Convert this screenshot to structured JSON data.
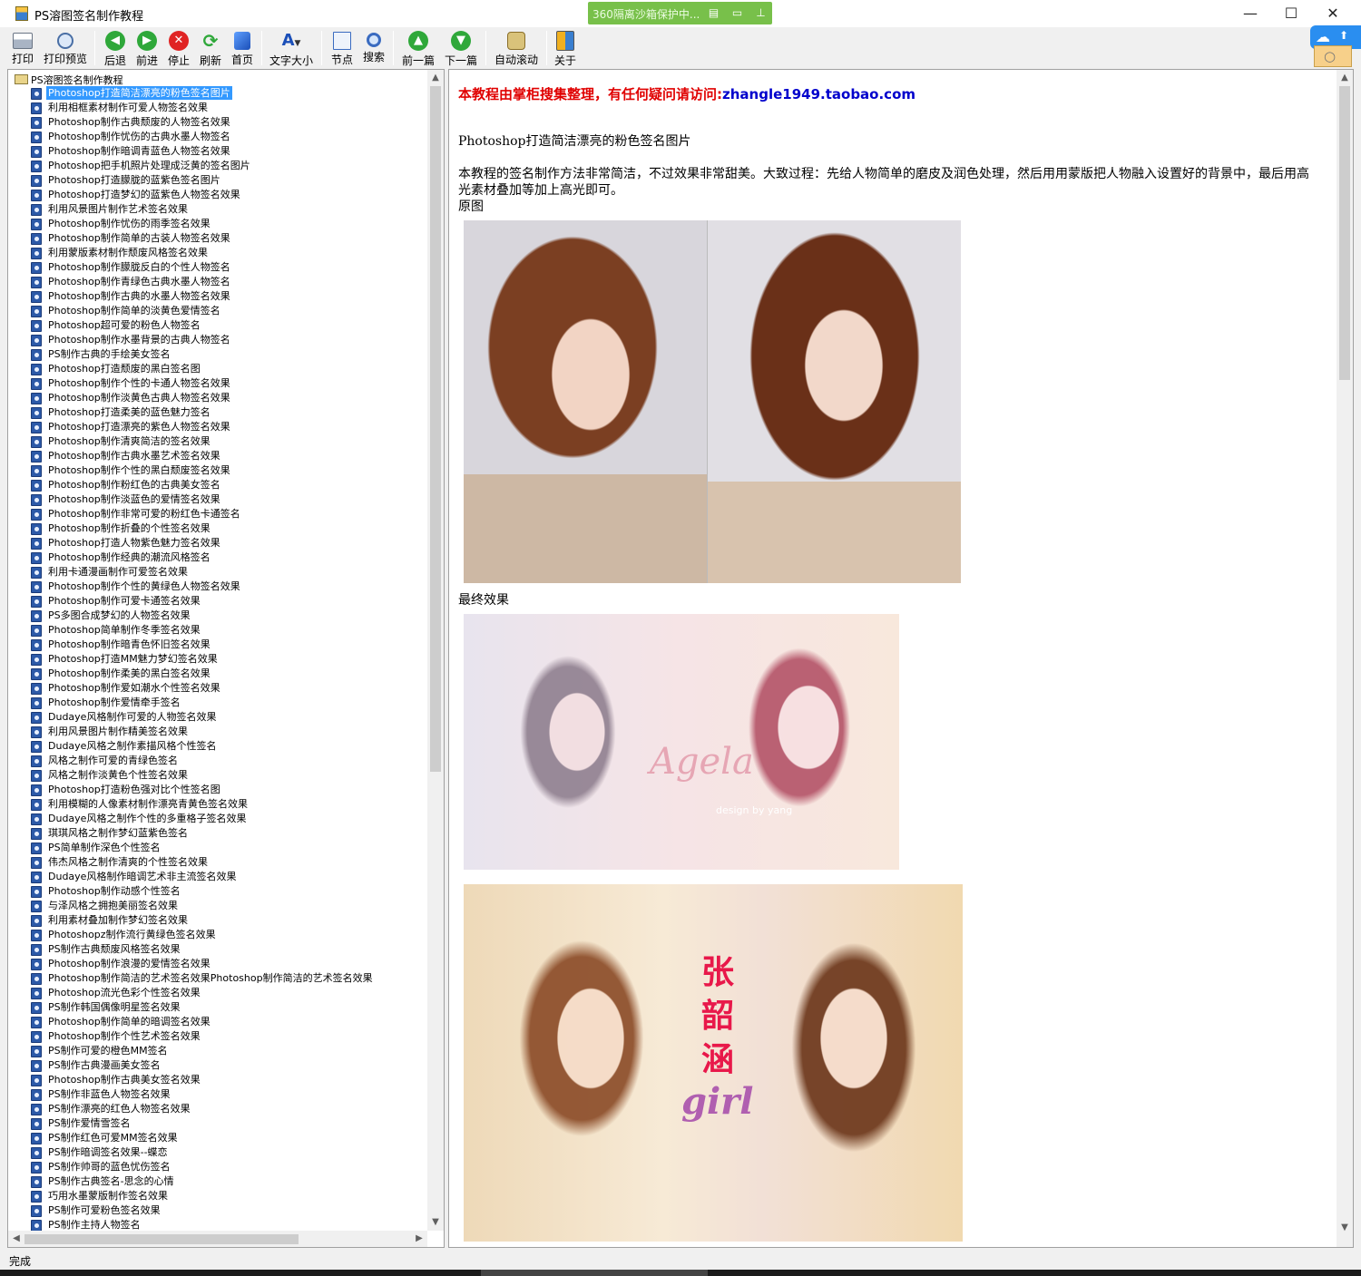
{
  "window": {
    "title": "PS溶图签名制作教程",
    "controls": {
      "minimize": "—",
      "maximize": "☐",
      "close": "✕"
    }
  },
  "overlay_360": {
    "text": "360隔离沙箱保护中..."
  },
  "toolbar": {
    "buttons": [
      {
        "label": "打印",
        "icon": "printer-icon"
      },
      {
        "label": "打印预览",
        "icon": "print-preview-icon"
      },
      {
        "label": "后退",
        "icon": "back-arrow-icon"
      },
      {
        "label": "前进",
        "icon": "forward-arrow-icon"
      },
      {
        "label": "停止",
        "icon": "stop-icon"
      },
      {
        "label": "刷新",
        "icon": "refresh-icon"
      },
      {
        "label": "首页",
        "icon": "home-icon"
      },
      {
        "label": "文字大小",
        "icon": "font-size-icon"
      },
      {
        "label": "节点",
        "icon": "node-icon"
      },
      {
        "label": "搜索",
        "icon": "search-icon"
      },
      {
        "label": "前一篇",
        "icon": "previous-article-icon"
      },
      {
        "label": "下一篇",
        "icon": "next-article-icon"
      },
      {
        "label": "自动滚动",
        "icon": "auto-scroll-icon"
      },
      {
        "label": "关于",
        "icon": "about-icon"
      }
    ]
  },
  "tree": {
    "root_label": "PS溶图签名制作教程",
    "selected_index": 0,
    "items": [
      "Photoshop打造简洁漂亮的粉色签名图片",
      "利用相框素材制作可爱人物签名效果",
      "Photoshop制作古典颓废的人物签名效果",
      "Photoshop制作忧伤的古典水墨人物签名",
      "Photoshop制作暗调青蓝色人物签名效果",
      "Photoshop把手机照片处理成泛黄的签名图片",
      "Photoshop打造朦胧的蓝紫色签名图片",
      "Photoshop打造梦幻的蓝紫色人物签名效果",
      "利用风景图片制作艺术签名效果",
      "Photoshop制作忧伤的雨季签名效果",
      "Photoshop制作简单的古装人物签名效果",
      "利用蒙版素材制作颓废风格签名效果",
      "Photoshop制作朦胧反白的个性人物签名",
      "Photoshop制作青绿色古典水墨人物签名",
      "Photoshop制作古典的水墨人物签名效果",
      "Photoshop制作简单的淡黄色爱情签名",
      "Photoshop超可爱的粉色人物签名",
      "Photoshop制作水墨背景的古典人物签名",
      "PS制作古典的手绘美女签名",
      "Photoshop打造颓废的黑白签名图",
      "Photoshop制作个性的卡通人物签名效果",
      "Photoshop制作淡黄色古典人物签名效果",
      "Photoshop打造柔美的蓝色魅力签名",
      "Photoshop打造漂亮的紫色人物签名效果",
      "Photoshop制作清爽简洁的签名效果",
      "Photoshop制作古典水墨艺术签名效果",
      "Photoshop制作个性的黑白颓废签名效果",
      "Photoshop制作粉红色的古典美女签名",
      "Photoshop制作淡蓝色的爱情签名效果",
      "Photoshop制作非常可爱的粉红色卡通签名",
      "Photoshop制作折叠的个性签名效果",
      "Photoshop打造人物紫色魅力签名效果",
      "Photoshop制作经典的潮流风格签名",
      "利用卡通漫画制作可爱签名效果",
      "Photoshop制作个性的黄绿色人物签名效果",
      "Photoshop制作可爱卡通签名效果",
      "PS多图合成梦幻的人物签名效果",
      "Photoshop简单制作冬季签名效果",
      "Photoshop制作暗青色怀旧签名效果",
      "Photoshop打造MM魅力梦幻签名效果",
      "Photoshop制作柔美的黑白签名效果",
      "Photoshop制作爱如潮水个性签名效果",
      "Photoshop制作爱情牵手签名",
      "Dudaye风格制作可爱的人物签名效果",
      "利用风景图片制作精美签名效果",
      "Dudaye风格之制作素描风格个性签名",
      "风格之制作可爱的青绿色签名",
      "风格之制作淡黄色个性签名效果",
      "Photoshop打造粉色强对比个性签名图",
      "利用模糊的人像素材制作漂亮青黄色签名效果",
      "Dudaye风格之制作个性的多重格子签名效果",
      "琪琪风格之制作梦幻蓝紫色签名",
      "PS简单制作深色个性签名",
      "伟杰风格之制作清爽的个性签名效果",
      "Dudaye风格制作暗调艺术非主流签名效果",
      "Photoshop制作动感个性签名",
      "与泽风格之拥抱美丽签名效果",
      "利用素材叠加制作梦幻签名效果",
      "Photoshopz制作流行黄绿色签名效果",
      "PS制作古典颓废风格签名效果",
      "Photoshop制作浪漫的爱情签名效果",
      "Photoshop制作简洁的艺术签名效果Photoshop制作简洁的艺术签名效果",
      "Photoshop流光色彩个性签名效果",
      "PS制作韩国偶像明星签名效果",
      "Photoshop制作简单的暗调签名效果",
      "Photoshop制作个性艺术签名效果",
      "PS制作可爱的橙色MM签名",
      "PS制作古典漫画美女签名",
      "Photoshop制作古典美女签名效果",
      "PS制作非蓝色人物签名效果",
      "PS制作漂亮的红色人物签名效果",
      "PS制作爱情雪签名",
      "PS制作红色可爱MM签名效果",
      "PS制作暗调签名效果--蝶恋",
      "PS制作帅哥的蓝色忧伤签名",
      "PS制作古典签名-思念的心情",
      "巧用水墨蒙版制作签名效果",
      "PS制作可爱粉色签名效果",
      "PS制作主持人物签名"
    ]
  },
  "content": {
    "notice_prefix": "本教程由掌柜搜集整理，有任何疑问请访问:",
    "notice_link": "zhangle1949.taobao.com",
    "article_title": "Photoshop打造简洁漂亮的粉色签名图片",
    "intro": "本教程的签名制作方法非常简洁，不过效果非常甜美。大致过程：先给人物简单的磨皮及润色处理，然后用用蒙版把人物融入设置好的背景中，最后用高光素材叠加等加上高光即可。",
    "label_original": "原图",
    "label_final": "最终效果",
    "image1_text": {
      "script": "Agela",
      "small": "design by yang"
    },
    "image2_text": {
      "chars": [
        "张",
        "韶",
        "涵"
      ],
      "girl": "girl"
    }
  },
  "status": {
    "text": "完成"
  },
  "colors": {
    "notice_red": "#e00000",
    "notice_link_blue": "#0000cc",
    "selection_blue": "#3399ff",
    "badge_green": "#78c04a",
    "cloud_blue": "#2a8ef0"
  }
}
